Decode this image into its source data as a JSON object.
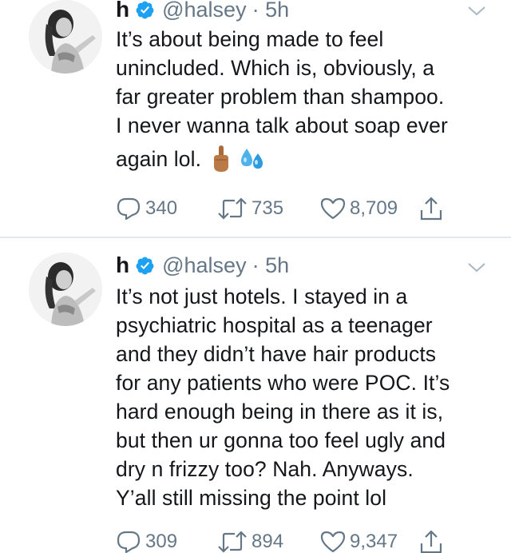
{
  "tweets": [
    {
      "name": "h",
      "handle": "@halsey",
      "time": "· 5h",
      "text_lines": [
        "It’s about being made to feel",
        "unincluded. Which is, obviously, a",
        "far greater problem than shampoo.",
        "I never wanna talk about soap ever",
        "again lol."
      ],
      "emojis": [
        "middle-finger-emoji",
        "sweat-droplets-emoji"
      ],
      "replies": "340",
      "retweets": "735",
      "likes": "8,709"
    },
    {
      "name": "h",
      "handle": "@halsey",
      "time": "· 5h",
      "text_lines": [
        "It’s not just hotels. I stayed in a",
        "psychiatric hospital as a teenager",
        "and they didn’t have hair products",
        "for any patients who were POC. It’s",
        "hard enough being in there as it is,",
        "but then ur gonna too feel ugly and",
        "dry n frizzy too? Nah. Anyways.",
        "Y’all still missing the point lol"
      ],
      "replies": "309",
      "retweets": "894",
      "likes": "9,347"
    }
  ],
  "icons": {
    "verified": "verified-badge-icon",
    "menu": "chevron-down-icon",
    "reply": "reply-icon",
    "retweet": "retweet-icon",
    "like": "heart-icon",
    "share": "share-icon"
  },
  "colors": {
    "verified_blue": "#1da1f2",
    "muted_gray": "#657786",
    "text": "#14171a",
    "divider": "#e1e8ed"
  }
}
